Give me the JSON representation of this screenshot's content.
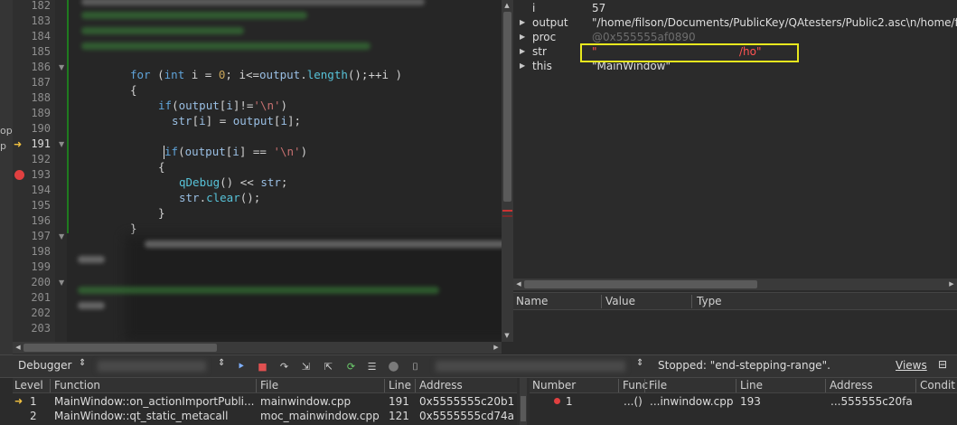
{
  "left_strip": {
    "line1": "op",
    "line2": "p"
  },
  "editor": {
    "lines": [
      {
        "n": "182",
        "cur": false,
        "fold": false
      },
      {
        "n": "183",
        "cur": false,
        "fold": false
      },
      {
        "n": "184",
        "cur": false,
        "fold": false
      },
      {
        "n": "185",
        "cur": false,
        "fold": false
      },
      {
        "n": "186",
        "cur": false,
        "fold": true
      },
      {
        "n": "187",
        "cur": false,
        "fold": false
      },
      {
        "n": "188",
        "cur": false,
        "fold": false
      },
      {
        "n": "189",
        "cur": false,
        "fold": false
      },
      {
        "n": "190",
        "cur": false,
        "fold": false
      },
      {
        "n": "191",
        "cur": true,
        "fold": true
      },
      {
        "n": "192",
        "cur": false,
        "fold": false
      },
      {
        "n": "193",
        "cur": false,
        "fold": false
      },
      {
        "n": "194",
        "cur": false,
        "fold": false
      },
      {
        "n": "195",
        "cur": false,
        "fold": false
      },
      {
        "n": "196",
        "cur": false,
        "fold": false
      },
      {
        "n": "197",
        "cur": false,
        "fold": true
      },
      {
        "n": "198",
        "cur": false,
        "fold": false
      },
      {
        "n": "199",
        "cur": false,
        "fold": false
      },
      {
        "n": "200",
        "cur": false,
        "fold": true
      },
      {
        "n": "201",
        "cur": false,
        "fold": false
      },
      {
        "n": "202",
        "cur": false,
        "fold": false
      },
      {
        "n": "203",
        "cur": false,
        "fold": false
      }
    ],
    "code": {
      "l186": "for (int i = 0; i<=output.length();++i )",
      "l187": "{",
      "l188": "if(output[i]!='\\n')",
      "l189": "str[i] = output[i];",
      "l191": "if(output[i] == '\\n')",
      "l192": "{",
      "l193": "qDebug() << str;",
      "l194": "str.clear();",
      "l195": "}",
      "l196": "}"
    },
    "colors": {
      "keyword": "#5fa3d9",
      "number": "#c9a65a",
      "function": "#57c2d8",
      "char": "#c77070",
      "change_bar": "#1f7a1f"
    },
    "current_line_icon": "arrow-right-icon",
    "breakpoint_icon": "breakpoint-dot-icon"
  },
  "locals": {
    "rows": [
      {
        "name": "i",
        "value": "57",
        "expandable": false
      },
      {
        "name": "output",
        "value": "\"/home/filson/Documents/PublicKey/QAtesters/Public2.asc\\n/home/fil",
        "expandable": true
      },
      {
        "name": "proc",
        "value": "@0x555555af0890",
        "expandable": true,
        "dim": true
      },
      {
        "name": "str",
        "value_left": "\"",
        "value_right": "/ho\"",
        "expandable": true,
        "red": true
      },
      {
        "name": "this",
        "value": "\"MainWindow\"",
        "expandable": true
      }
    ],
    "highlight_color": "#e8e81e"
  },
  "watchers": {
    "headers": [
      "Name",
      "Value",
      "Type"
    ]
  },
  "toolbar": {
    "debugger_label": "Debugger",
    "status": "Stopped: \"end-stepping-range\".",
    "views_label": "Views",
    "icons": [
      "continue-icon",
      "stop-icon",
      "step-over-icon",
      "step-into-icon",
      "step-out-icon",
      "restart-icon",
      "operate-by-instruction-icon",
      "record-icon",
      "snapshot-icon"
    ]
  },
  "stack": {
    "headers": [
      "Level",
      "Function",
      "File",
      "Line",
      "Address"
    ],
    "rows": [
      {
        "level": "1",
        "function": "MainWindow::on_actionImportPubli...",
        "file": "mainwindow.cpp",
        "line": "191",
        "address": "0x5555555c20b1",
        "current": true
      },
      {
        "level": "2",
        "function": "MainWindow::qt_static_metacall",
        "file": "moc_mainwindow.cpp",
        "line": "121",
        "address": "0x5555555cd74a",
        "current": false
      }
    ]
  },
  "breakpoints": {
    "headers": [
      "Number",
      "Func",
      "File",
      "Line",
      "Address",
      "Condit"
    ],
    "rows": [
      {
        "number": "1",
        "function": "...()",
        "file": "...inwindow.cpp",
        "line": "193",
        "address": "...555555c20fa"
      }
    ]
  }
}
